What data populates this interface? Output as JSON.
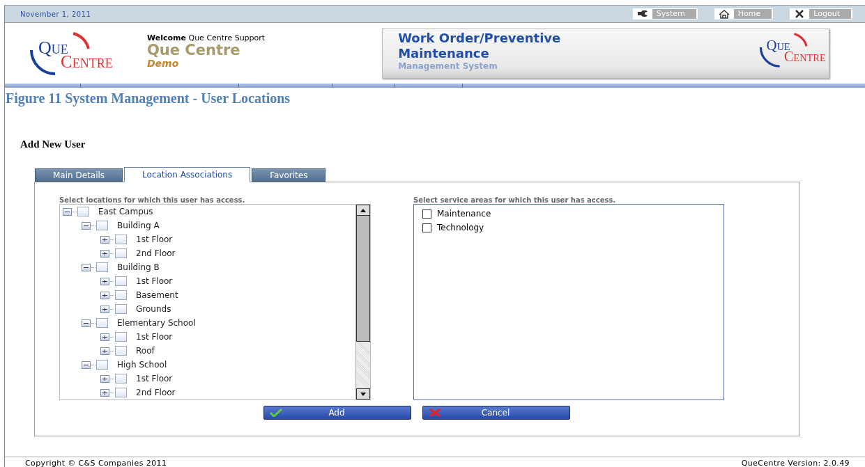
{
  "top_bar": {
    "date": "November 1, 2011",
    "links": [
      {
        "label": "System"
      },
      {
        "label": "Home"
      },
      {
        "label": "Logout"
      }
    ]
  },
  "header": {
    "logo": {
      "line1": "Que",
      "line2": "Centre"
    },
    "welcome_label": "Welcome",
    "user": "Que Centre Support",
    "site_name": "Que Centre",
    "site_sub": "Demo",
    "banner": {
      "title": "Work Order/Preventive Maintenance",
      "subtitle": "Management System",
      "logo": {
        "line1": "Que",
        "line2": "Centre"
      }
    }
  },
  "caption": "Figure 11 System Management - User Locations",
  "form_title": "Add New User",
  "tabs": [
    {
      "label": "Main Details",
      "selected": false
    },
    {
      "label": "Location Associations",
      "selected": true
    },
    {
      "label": "Favorites",
      "selected": false
    }
  ],
  "locations": {
    "label": "Select locations for which this user has access.",
    "items": [
      {
        "label": "East Campus",
        "expanded": true,
        "checked": false,
        "children": [
          {
            "label": "Building A",
            "expanded": true,
            "checked": false,
            "children": [
              {
                "label": "1st Floor",
                "expanded": false,
                "checked": false
              },
              {
                "label": "2nd Floor",
                "expanded": false,
                "checked": false
              }
            ]
          },
          {
            "label": "Building B",
            "expanded": true,
            "checked": false,
            "children": [
              {
                "label": "1st Floor",
                "expanded": false,
                "checked": false
              },
              {
                "label": "Basement",
                "expanded": false,
                "checked": false
              },
              {
                "label": "Grounds",
                "expanded": false,
                "checked": false
              }
            ]
          },
          {
            "label": "Elementary School",
            "expanded": true,
            "checked": false,
            "children": [
              {
                "label": "1st Floor",
                "expanded": false,
                "checked": false
              },
              {
                "label": "Roof",
                "expanded": false,
                "checked": false
              }
            ]
          },
          {
            "label": "High School",
            "expanded": true,
            "checked": false,
            "children": [
              {
                "label": "1st Floor",
                "expanded": false,
                "checked": false
              },
              {
                "label": "2nd Floor",
                "expanded": false,
                "checked": false
              }
            ]
          }
        ]
      }
    ]
  },
  "service_areas": {
    "label": "Select service areas for which this user has access.",
    "items": [
      {
        "label": "Maintenance",
        "checked": false
      },
      {
        "label": "Technology",
        "checked": false
      }
    ]
  },
  "buttons": [
    {
      "label": "Add",
      "kind": "ok"
    },
    {
      "label": "Cancel",
      "kind": "cancel"
    }
  ],
  "footer": {
    "copyright": "Copyright © C&S Companies 2011",
    "version": "QueCentre Version: 2.0.49"
  }
}
